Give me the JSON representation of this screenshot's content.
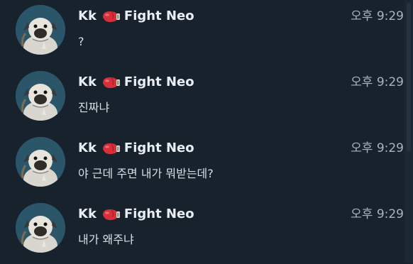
{
  "messages": [
    {
      "nick": "Kk",
      "name": "Fight Neo",
      "time": "오후 9:29",
      "text": "?"
    },
    {
      "nick": "Kk",
      "name": "Fight Neo",
      "time": "오후 9:29",
      "text": "진짜냐"
    },
    {
      "nick": "Kk",
      "name": "Fight Neo",
      "time": "오후 9:29",
      "text": "야 근데 주면 내가 뭐받는데?"
    },
    {
      "nick": "Kk",
      "name": "Fight Neo",
      "time": "오후 9:29",
      "text": "내가 왜주냐"
    }
  ],
  "icons": {
    "avatar": "pug-avatar",
    "sender_emoji": "boxing-glove-icon"
  },
  "colors": {
    "background": "#18222d",
    "name": "#e8eef3",
    "time": "#a8b4bf",
    "text": "#d7dfe6",
    "glove": "#d8303a"
  }
}
